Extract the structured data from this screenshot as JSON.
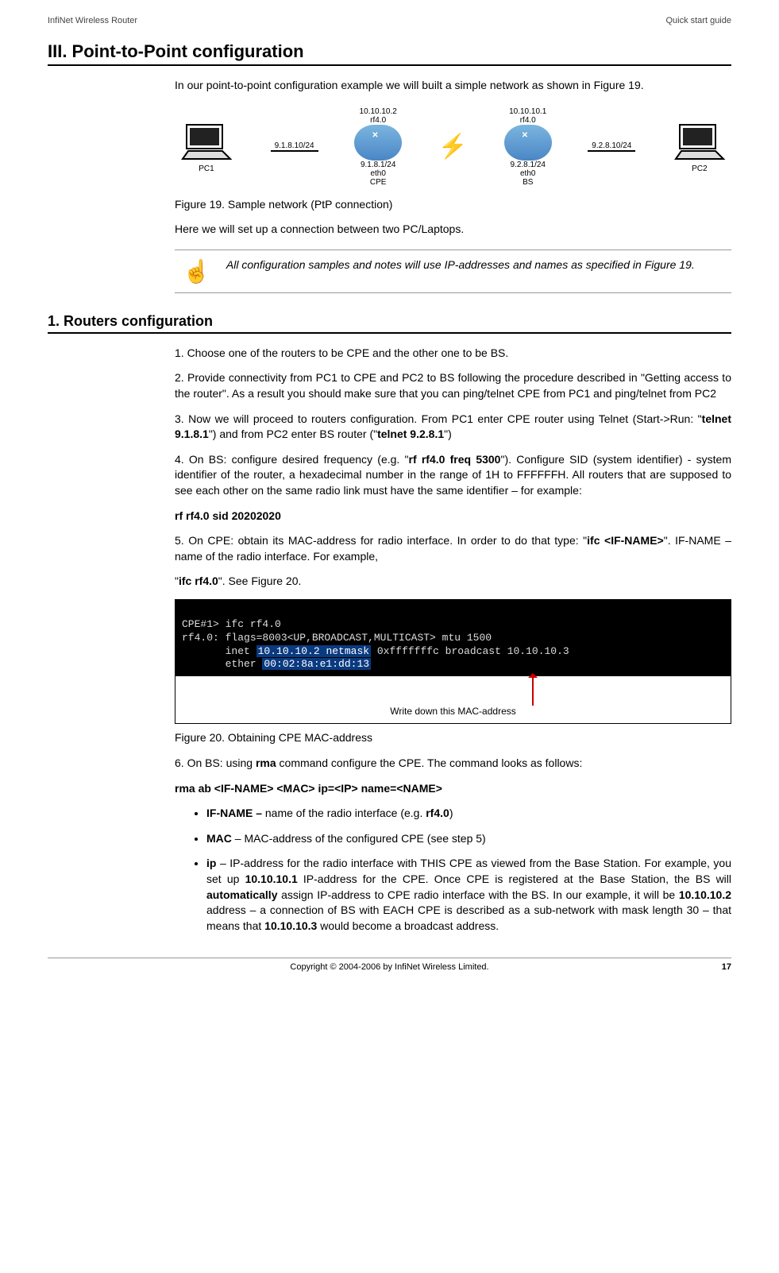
{
  "header": {
    "left": "InfiNet Wireless Router",
    "right": "Quick start guide"
  },
  "section_title": "III. Point-to-Point configuration",
  "intro": "In our point-to-point configuration example we will built a simple network as shown in Figure 19.",
  "diagram": {
    "pc1": "PC1",
    "pc2": "PC2",
    "cpe": "CPE",
    "bs": "BS",
    "pc1_ip": "9.1.8.10/24",
    "pc2_ip": "9.2.8.10/24",
    "cpe_eth": "9.1.8.1/24\neth0",
    "bs_eth": "9.2.8.1/24\neth0",
    "cpe_rf": "10.10.10.2\nrf4.0",
    "bs_rf": "10.10.10.1\nrf4.0"
  },
  "fig19_caption": "Figure 19. Sample network (PtP connection)",
  "here_text": "Here we will set up a connection between two PC/Laptops.",
  "note": "All configuration samples and notes will use IP-addresses and names as specified in Figure 19.",
  "subsection": "1. Routers configuration",
  "step1": "1. Choose one of the routers to be CPE and the other one to be BS.",
  "step2": "2. Provide connectivity from PC1 to CPE and PC2 to BS following the procedure described in \"Getting access to the router\". As a result you should make sure that you can ping/telnet CPE from PC1 and ping/telnet from PC2",
  "step3_a": "3. Now we will proceed to routers configuration. From PC1 enter CPE router using Telnet (Start->Run: \"",
  "step3_b": "telnet 9.1.8.1",
  "step3_c": "\") and from PC2 enter BS router (\"",
  "step3_d": "telnet 9.2.8.1",
  "step3_e": "\")",
  "step4_a": "4. On BS: configure desired frequency (e.g. \"",
  "step4_b": "rf rf4.0 freq 5300",
  "step4_c": "\"). Configure SID (system identifier) - system identifier of the router, a hexadecimal number in the range of 1H to FFFFFFH. All routers that are supposed to see each other on the same radio link must have the same identifier – for example:",
  "step4_cmd": "rf rf4.0 sid 20202020",
  "step5_a": "5. On CPE: obtain its MAC-address for radio interface. In order to do that type: \"",
  "step5_b": "ifc <IF-NAME>",
  "step5_c": "\". IF-NAME – name of the radio interface. For example,",
  "step5_d": "\"",
  "step5_e": "ifc rf4.0",
  "step5_f": "\". See Figure 20.",
  "terminal": {
    "line1": "CPE#1> ifc rf4.0",
    "line2": "rf4.0: flags=8003<UP,BROADCAST,MULTICAST> mtu 1500",
    "line3_a": "       inet ",
    "line3_b": "10.10.10.2 netmask",
    "line3_c": " 0xfffffffc broadcast 10.10.10.3",
    "line4_a": "       ether ",
    "line4_b": "00:02:8a:e1:dd:13",
    "note": "Write down this MAC-address"
  },
  "fig20_caption": "Figure 20. Obtaining CPE MAC-address",
  "step6_a": "6. On BS: using ",
  "step6_b": "rma",
  "step6_c": " command configure the CPE. The command looks as follows:",
  "step6_cmd": "rma ab <IF-NAME> <MAC> ip=<IP> name=<NAME>",
  "bul1_a": "IF-NAME – ",
  "bul1_b": "name of the radio interface (e.g. ",
  "bul1_c": "rf4.0",
  "bul1_d": ")",
  "bul2_a": "MAC",
  "bul2_b": " – MAC-address of the configured CPE (see step 5)",
  "bul3_a": "ip",
  "bul3_b": " – IP-address for the radio interface with THIS CPE as viewed from the Base Station. For example, you set up ",
  "bul3_c": "10.10.10.1",
  "bul3_d": " IP-address for the CPE. Once CPE is registered at the Base Station, the BS will ",
  "bul3_e": "automatically",
  "bul3_f": " assign IP-address to CPE radio interface with the BS. In our example, it will be ",
  "bul3_g": "10.10.10.2",
  "bul3_h": " address – a connection of BS with EACH CPE is described as a sub-network with mask length 30 – that means that ",
  "bul3_i": "10.10.10.3",
  "bul3_j": " would become a broadcast address.",
  "footer": {
    "copyright": "Copyright © 2004-2006 by InfiNet Wireless Limited.",
    "page": "17"
  }
}
